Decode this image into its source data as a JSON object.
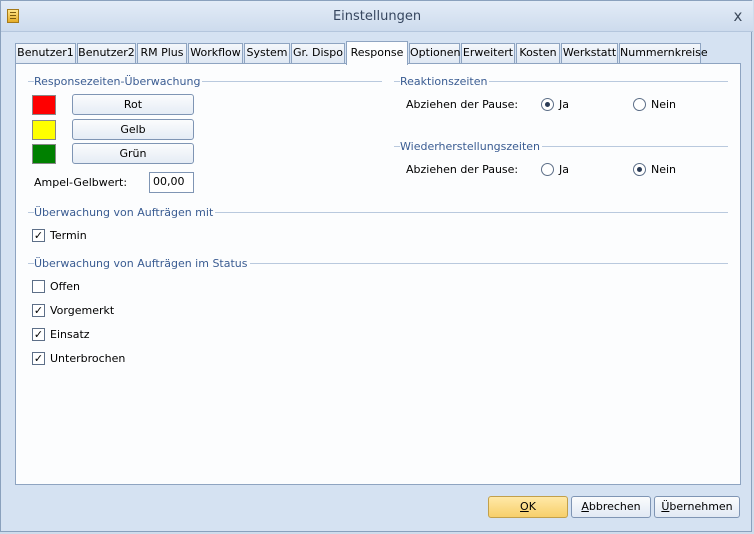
{
  "window": {
    "title": "Einstellungen",
    "close_glyph": "x",
    "app_icon": "ledger-icon"
  },
  "tabs": [
    {
      "label": "Benutzer1",
      "active": false
    },
    {
      "label": "Benutzer2",
      "active": false
    },
    {
      "label": "RM Plus",
      "active": false
    },
    {
      "label": "Workflow",
      "active": false
    },
    {
      "label": "System",
      "active": false
    },
    {
      "label": "Gr. Dispo",
      "active": false
    },
    {
      "label": "Response",
      "active": true
    },
    {
      "label": "Optionen",
      "active": false
    },
    {
      "label": "Erweitert",
      "active": false
    },
    {
      "label": "Kosten",
      "active": false
    },
    {
      "label": "Werkstatt",
      "active": false
    },
    {
      "label": "Nummernkreise",
      "active": false
    }
  ],
  "response_monitoring": {
    "title": "Responsezeiten-Überwachung",
    "colors": [
      {
        "label": "Rot",
        "swatch": "#ff0000"
      },
      {
        "label": "Gelb",
        "swatch": "#ffff00"
      },
      {
        "label": "Grün",
        "swatch": "#008000"
      }
    ],
    "threshold_label": "Ampel-Gelbwert:",
    "threshold_value": "00,00"
  },
  "reaction_times": {
    "title": "Reaktionszeiten",
    "pause_label": "Abziehen der Pause:",
    "options": [
      "Ja",
      "Nein"
    ],
    "selected": "Ja"
  },
  "restore_times": {
    "title": "Wiederherstellungszeiten",
    "pause_label": "Abziehen der Pause:",
    "options": [
      "Ja",
      "Nein"
    ],
    "selected": "Nein"
  },
  "orders_with": {
    "title": "Überwachung von Aufträgen mit",
    "items": [
      {
        "label": "Termin",
        "checked": true
      }
    ]
  },
  "orders_status": {
    "title": "Überwachung von Aufträgen im Status",
    "items": [
      {
        "label": "Offen",
        "checked": false
      },
      {
        "label": "Vorgemerkt",
        "checked": true
      },
      {
        "label": "Einsatz",
        "checked": true
      },
      {
        "label": "Unterbrochen",
        "checked": true
      }
    ]
  },
  "footer": {
    "ok": {
      "mnemonic": "O",
      "rest": "K"
    },
    "cancel": {
      "mnemonic": "A",
      "rest": "bbrechen"
    },
    "apply": {
      "mnemonic": "Ü",
      "rest": "bernehmen"
    }
  }
}
